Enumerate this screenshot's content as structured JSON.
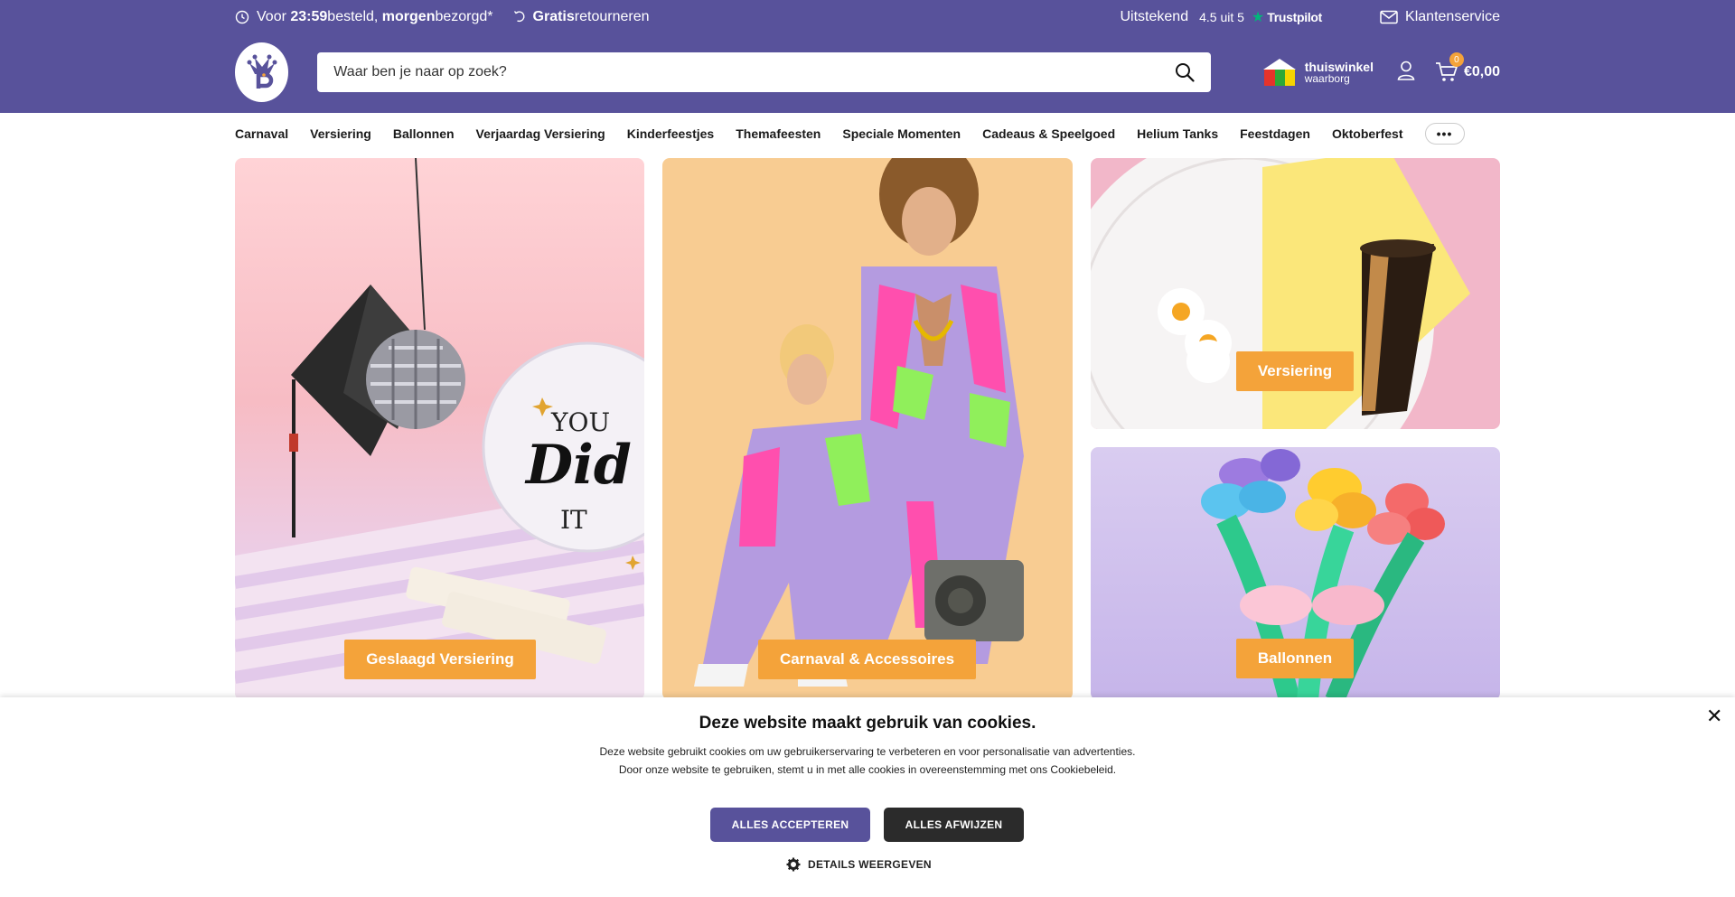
{
  "usp": {
    "delivery_pre": "Voor ",
    "delivery_time": "23:59",
    "delivery_mid": " besteld, ",
    "delivery_day": "morgen",
    "delivery_post": " bezorgd*",
    "returns_bold": "Gratis",
    "returns_rest": " retourneren",
    "trustpilot_word": "Uitstekend",
    "trustpilot_score": "4.5 uit 5",
    "trustpilot_brand": "Trustpilot",
    "service_label": "Klantenservice"
  },
  "header": {
    "search_placeholder": "Waar ben je naar op zoek?",
    "thuiswinkel_line1": "thuiswinkel",
    "thuiswinkel_line2": "waarborg",
    "cart_count": "0",
    "cart_total": "€0,00"
  },
  "nav": {
    "items": [
      "Carnaval",
      "Versiering",
      "Ballonnen",
      "Verjaardag Versiering",
      "Kinderfeestjes",
      "Themafeesten",
      "Speciale Momenten",
      "Cadeaus & Speelgoed",
      "Helium Tanks",
      "Feestdagen",
      "Oktoberfest"
    ],
    "more_label": "•••"
  },
  "tiles": {
    "graduation": {
      "cta": "Geslaagd Versiering",
      "balloon_you": "YOU",
      "balloon_did": "Did",
      "balloon_it": "IT"
    },
    "carnival": {
      "cta": "Carnaval & Accessoires"
    },
    "decoration": {
      "cta": "Versiering"
    },
    "balloons": {
      "cta": "Ballonnen"
    }
  },
  "cookie": {
    "title": "Deze website maakt gebruik van cookies.",
    "body": "Deze website gebruikt cookies om uw gebruikerservaring te verbeteren en voor personalisatie van advertenties. Door onze website te gebruiken, stemt u in met alle cookies in overeenstemming met ons Cookiebeleid.",
    "accept": "ALLES ACCEPTEREN",
    "reject": "ALLES AFWIJZEN",
    "details": "DETAILS WEERGEVEN",
    "close": "✕"
  },
  "colors": {
    "brand_purple": "#58529b",
    "accent_orange": "#f4a33a",
    "trustpilot_green": "#00b67a"
  }
}
